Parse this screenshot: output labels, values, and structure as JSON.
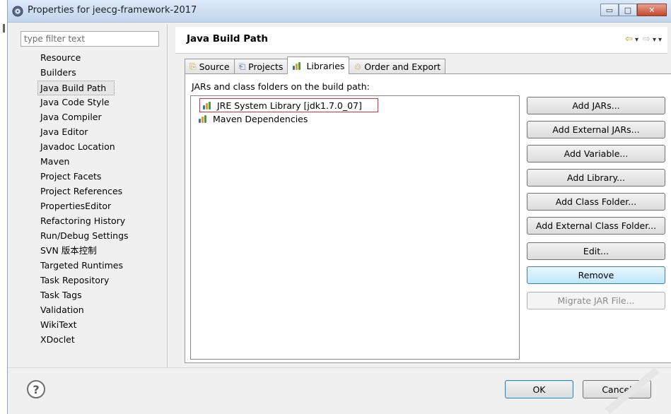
{
  "window": {
    "title": "Properties for jeecg-framework-2017",
    "minimize_glyph": "▭",
    "maximize_glyph": "□",
    "close_glyph": "✕"
  },
  "sidebar": {
    "filter_placeholder": "type filter text",
    "items": [
      {
        "label": "Resource"
      },
      {
        "label": "Builders"
      },
      {
        "label": "Java Build Path",
        "selected": true
      },
      {
        "label": "Java Code Style"
      },
      {
        "label": "Java Compiler"
      },
      {
        "label": "Java Editor"
      },
      {
        "label": "Javadoc Location"
      },
      {
        "label": "Maven"
      },
      {
        "label": "Project Facets"
      },
      {
        "label": "Project References"
      },
      {
        "label": "PropertiesEditor"
      },
      {
        "label": "Refactoring History"
      },
      {
        "label": "Run/Debug Settings"
      },
      {
        "label": "SVN 版本控制"
      },
      {
        "label": "Targeted Runtimes"
      },
      {
        "label": "Task Repository"
      },
      {
        "label": "Task Tags"
      },
      {
        "label": "Validation"
      },
      {
        "label": "WikiText"
      },
      {
        "label": "XDoclet"
      }
    ]
  },
  "page": {
    "title": "Java Build Path",
    "nav": {
      "back": "⇦",
      "forward": "⇨",
      "dropdown": "▾"
    }
  },
  "tabs": [
    {
      "label": "Source",
      "icon": "source-folder-icon",
      "glyph": "⎘"
    },
    {
      "label": "Projects",
      "icon": "projects-folder-icon",
      "glyph": "⎗"
    },
    {
      "label": "Libraries",
      "icon": "libraries-icon",
      "active": true
    },
    {
      "label": "Order and Export",
      "icon": "order-export-icon",
      "glyph": "♲"
    }
  ],
  "libraries": {
    "caption": "JARs and class folders on the build path:",
    "items": [
      {
        "label": "JRE System Library [jdk1.7.0_07]",
        "highlighted": true,
        "highlight_color": "#e0303a"
      },
      {
        "label": "Maven Dependencies"
      }
    ]
  },
  "buttons": {
    "add_jars": "Add JARs...",
    "add_external_jars": "Add External JARs...",
    "add_variable": "Add Variable...",
    "add_library": "Add Library...",
    "add_class_folder": "Add Class Folder...",
    "add_external_class_folder": "Add External Class Folder...",
    "edit": "Edit...",
    "remove": "Remove",
    "migrate_jar": "Migrate JAR File..."
  },
  "footer": {
    "help_glyph": "?",
    "ok": "OK",
    "cancel": "Cancel"
  },
  "colors": {
    "accent_blue": "#3c7fb1",
    "highlight_red": "#e0303a",
    "nav_arrow": "#c69a2a"
  }
}
